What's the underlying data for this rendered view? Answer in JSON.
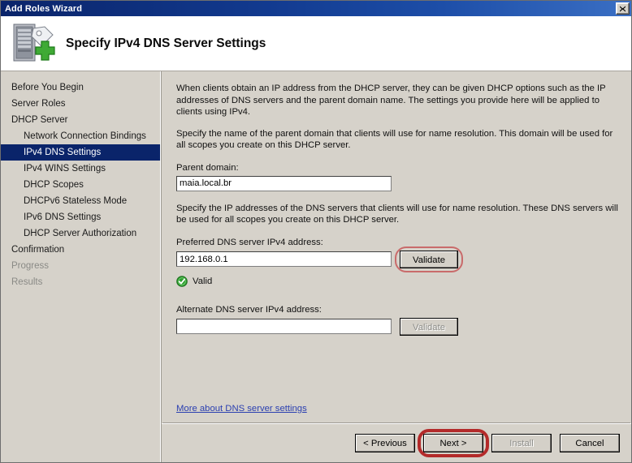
{
  "window": {
    "title": "Add Roles Wizard",
    "close_icon": "close-icon"
  },
  "header": {
    "title": "Specify IPv4 DNS Server Settings",
    "icon": "server-add-icon"
  },
  "sidebar": {
    "items": [
      {
        "label": "Before You Begin",
        "level": 0,
        "state": "normal"
      },
      {
        "label": "Server Roles",
        "level": 0,
        "state": "normal"
      },
      {
        "label": "DHCP Server",
        "level": 0,
        "state": "normal"
      },
      {
        "label": "Network Connection Bindings",
        "level": 1,
        "state": "normal"
      },
      {
        "label": "IPv4 DNS Settings",
        "level": 1,
        "state": "selected"
      },
      {
        "label": "IPv4 WINS Settings",
        "level": 1,
        "state": "normal"
      },
      {
        "label": "DHCP Scopes",
        "level": 1,
        "state": "normal"
      },
      {
        "label": "DHCPv6 Stateless Mode",
        "level": 1,
        "state": "normal"
      },
      {
        "label": "IPv6 DNS Settings",
        "level": 1,
        "state": "normal"
      },
      {
        "label": "DHCP Server Authorization",
        "level": 1,
        "state": "normal"
      },
      {
        "label": "Confirmation",
        "level": 0,
        "state": "normal"
      },
      {
        "label": "Progress",
        "level": 0,
        "state": "disabled"
      },
      {
        "label": "Results",
        "level": 0,
        "state": "disabled"
      }
    ]
  },
  "content": {
    "paragraph1": "When clients obtain an IP address from the DHCP server, they can be given DHCP options such as the IP addresses of DNS servers and the parent domain name. The settings you provide here will be applied to clients using IPv4.",
    "paragraph2": "Specify the name of the parent domain that clients will use for name resolution. This domain will be used for all scopes you create on this DHCP server.",
    "parent_domain_label": "Parent domain:",
    "parent_domain_value": "maia.local.br",
    "parent_domain_placeholder": "",
    "paragraph3": "Specify the IP addresses of the DNS servers that clients will use for name resolution. These DNS servers will be used for all scopes you create on this DHCP server.",
    "preferred_label": "Preferred DNS server IPv4 address:",
    "preferred_value": "192.168.0.1",
    "preferred_placeholder": "",
    "validate_label": "Validate",
    "valid_status": "Valid",
    "valid_icon": "green-check-icon",
    "alternate_label": "Alternate DNS server IPv4 address:",
    "alternate_value": "",
    "alternate_placeholder": "",
    "alternate_validate_label": "Validate",
    "more_link": "More about DNS server settings"
  },
  "footer": {
    "previous_label": "< Previous",
    "next_label": "Next >",
    "install_label": "Install",
    "cancel_label": "Cancel"
  },
  "colors": {
    "titlebar": "#0a246a",
    "selection": "#0a246a",
    "window_bg": "#d6d2ca",
    "annotation_red": "#b32a2a",
    "annotation_pink": "#c96b6b",
    "link": "#2a3fb0",
    "valid_green": "#2f9e2f"
  }
}
